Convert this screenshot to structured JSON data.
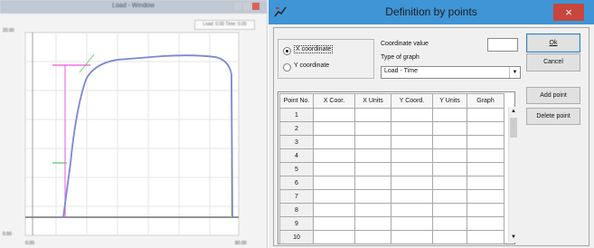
{
  "graph_window": {
    "title": "Load - Window",
    "y_axis_top": "20.00",
    "y_axis_bottom": "0.00",
    "x_axis_left": "0.00",
    "x_axis_right": "80.00",
    "top_field_text": "Load: 0.00  Time: 0.00",
    "colors": {
      "curve": "#7b86d6",
      "green_marker": "#58c964",
      "magenta_marker": "#e84fe0",
      "yellow_marker": "#e2e35b"
    }
  },
  "dialog": {
    "title": "Definition by points",
    "close_glyph": "×",
    "radio_x_label": "X coordinate",
    "radio_y_label": "Y coordinate",
    "radio_selected": "x",
    "coordinate_value_label": "Coordinate value",
    "coordinate_value": "",
    "type_of_graph_label": "Type of graph",
    "type_of_graph_value": "Load - Time",
    "ok_button": "Ok",
    "cancel_button": "Cancel",
    "add_point_button": "Add point",
    "delete_point_button": "Delete point",
    "table": {
      "headers": [
        "Point No.",
        "X Coor.",
        "X Units",
        "Y Coord.",
        "Y Units",
        "Graph"
      ],
      "rows": [
        [
          "1",
          "",
          "",
          "",
          "",
          ""
        ],
        [
          "2",
          "",
          "",
          "",
          "",
          ""
        ],
        [
          "3",
          "",
          "",
          "",
          "",
          ""
        ],
        [
          "4",
          "",
          "",
          "",
          "",
          ""
        ],
        [
          "5",
          "",
          "",
          "",
          "",
          ""
        ],
        [
          "6",
          "",
          "",
          "",
          "",
          ""
        ],
        [
          "7",
          "",
          "",
          "",
          "",
          ""
        ],
        [
          "8",
          "",
          "",
          "",
          "",
          ""
        ],
        [
          "9",
          "",
          "",
          "",
          "",
          ""
        ],
        [
          "10",
          "",
          "",
          "",
          "",
          ""
        ]
      ]
    },
    "colors": {
      "titlebar": "#3f95d6",
      "close": "#c7463d"
    }
  }
}
